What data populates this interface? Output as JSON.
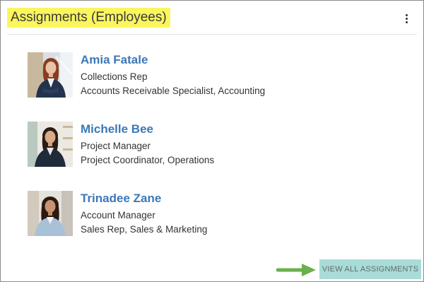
{
  "header": {
    "title": "Assignments (Employees)",
    "menu_icon": "kebab-menu-icon"
  },
  "employees": [
    {
      "name": "Amia Fatale",
      "title": "Collections Rep",
      "roles": "Accounts Receivable Specialist, Accounting",
      "hair_color": "#8a3b22",
      "suit_color": "#23334d"
    },
    {
      "name": "Michelle Bee",
      "title": "Project Manager",
      "roles": "Project Coordinator, Operations",
      "hair_color": "#2a1c14",
      "suit_color": "#1f2a3a"
    },
    {
      "name": "Trinadee Zane",
      "title": "Account Manager",
      "roles": "Sales Rep, Sales & Marketing",
      "hair_color": "#2b1a12",
      "suit_color": "#a9c1d6"
    }
  ],
  "footer": {
    "view_all_label": "VIEW ALL ASSIGNMENTS",
    "accent_color": "#a9dcd8",
    "arrow_color": "#6ab04c"
  }
}
